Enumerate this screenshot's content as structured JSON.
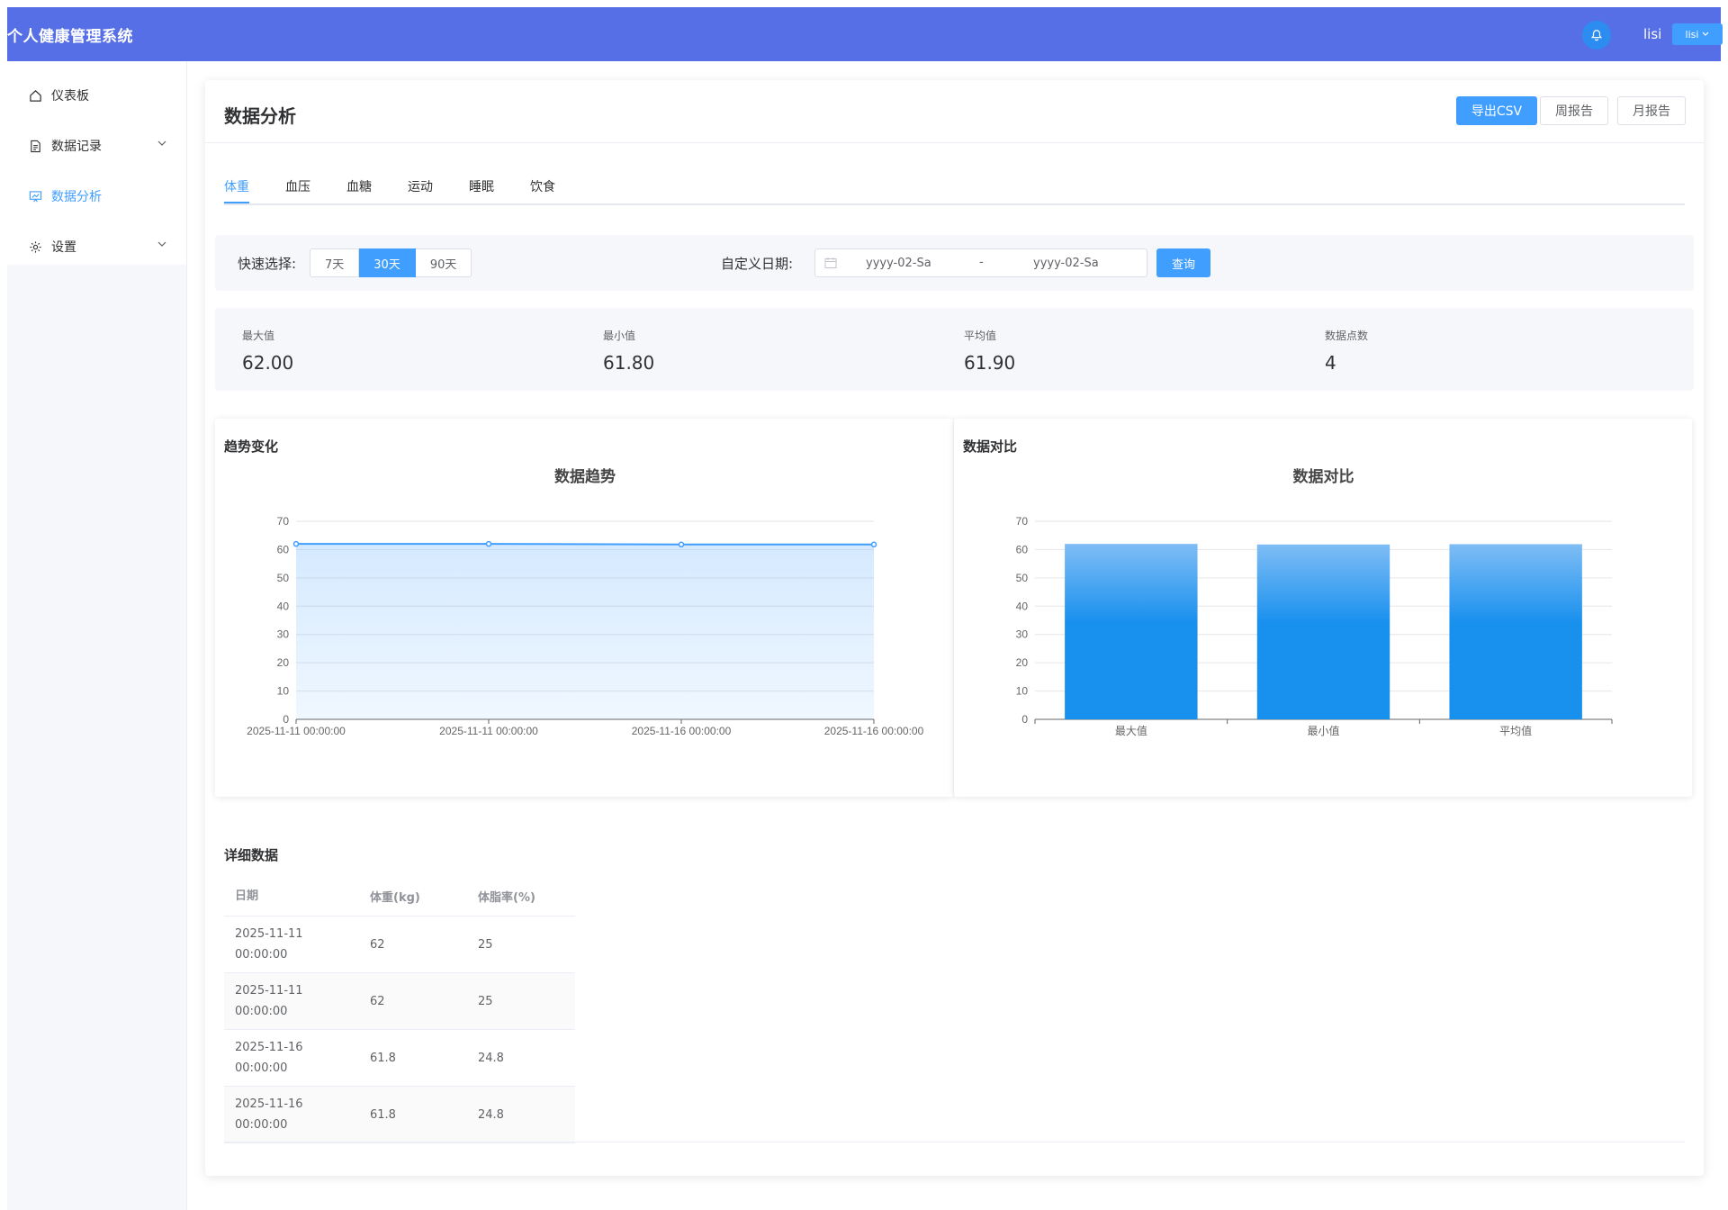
{
  "header": {
    "app_title": "个人健康管理系统",
    "username": "lisi",
    "user_dropdown": "lisi"
  },
  "sidebar": {
    "items": [
      {
        "label": "仪表板"
      },
      {
        "label": "数据记录"
      },
      {
        "label": "数据分析"
      },
      {
        "label": "设置"
      }
    ]
  },
  "page": {
    "title": "数据分析",
    "actions": {
      "export_csv": "导出CSV",
      "weekly_report": "周报告",
      "monthly_report": "月报告"
    },
    "tabs": [
      "体重",
      "血压",
      "血糖",
      "运动",
      "睡眠",
      "饮食"
    ]
  },
  "filter": {
    "quick_label": "快速选择:",
    "ranges": [
      "7天",
      "30天",
      "90天"
    ],
    "custom_label": "自定义日期:",
    "start_placeholder": "yyyy-02-Sa",
    "separator": "-",
    "end_placeholder": "yyyy-02-Sa",
    "query_button": "查询"
  },
  "stats": [
    {
      "label": "最大值",
      "value": "62.00"
    },
    {
      "label": "最小值",
      "value": "61.80"
    },
    {
      "label": "平均值",
      "value": "61.90"
    },
    {
      "label": "数据点数",
      "value": "4"
    }
  ],
  "chart_data": [
    {
      "type": "area",
      "panel_label": "趋势变化",
      "title": "数据趋势",
      "categories": [
        "2025-11-11 00:00:00",
        "2025-11-11 00:00:00",
        "2025-11-16 00:00:00",
        "2025-11-16 00:00:00"
      ],
      "values": [
        62,
        62,
        61.8,
        61.8
      ],
      "ylim": [
        0,
        70
      ],
      "yticks": [
        0,
        10,
        20,
        30,
        40,
        50,
        60,
        70
      ],
      "grid": true
    },
    {
      "type": "bar",
      "panel_label": "数据对比",
      "title": "数据对比",
      "categories": [
        "最大值",
        "最小值",
        "平均值"
      ],
      "values": [
        62,
        61.8,
        61.9
      ],
      "ylim": [
        0,
        70
      ],
      "yticks": [
        0,
        10,
        20,
        30,
        40,
        50,
        60,
        70
      ],
      "grid": true
    }
  ],
  "detail": {
    "title": "详细数据",
    "columns": [
      "日期",
      "体重(kg)",
      "体脂率(%)"
    ],
    "rows": [
      {
        "date": "2025-11-11",
        "time": "00:00:00",
        "weight": "62",
        "fat": "25"
      },
      {
        "date": "2025-11-11",
        "time": "00:00:00",
        "weight": "62",
        "fat": "25"
      },
      {
        "date": "2025-11-16",
        "time": "00:00:00",
        "weight": "61.8",
        "fat": "24.8"
      },
      {
        "date": "2025-11-16",
        "time": "00:00:00",
        "weight": "61.8",
        "fat": "24.8"
      }
    ]
  },
  "colors": {
    "header": "#566fe6",
    "primary": "#409eff",
    "bar": "#1890ee",
    "line": "#409eff"
  }
}
